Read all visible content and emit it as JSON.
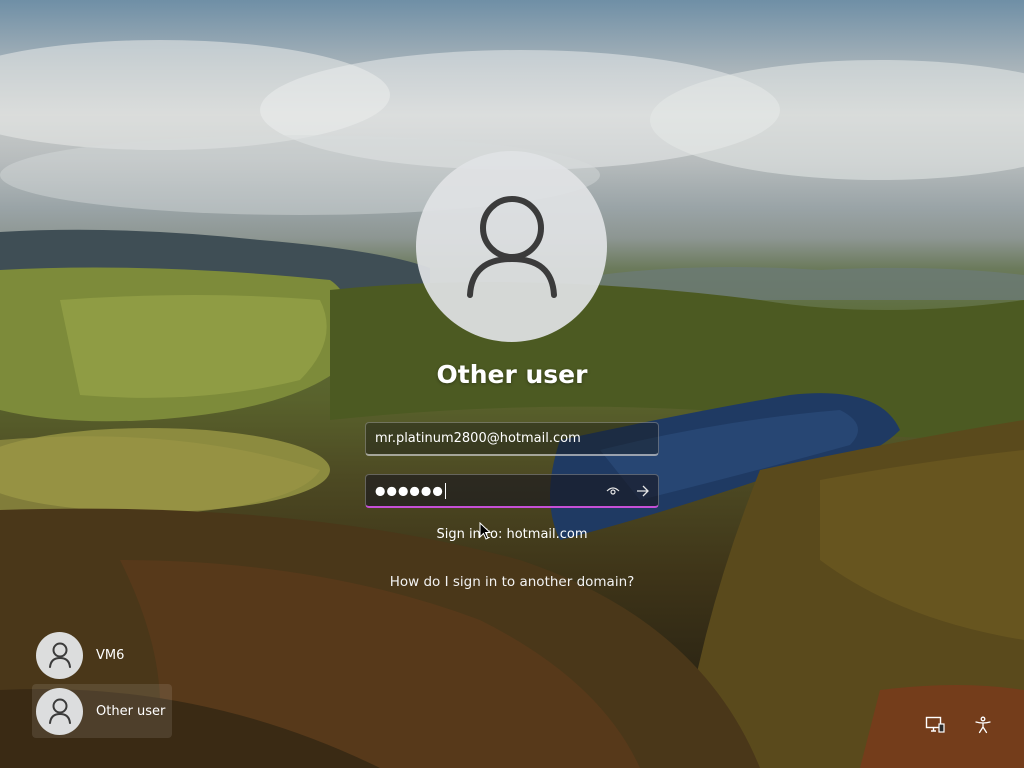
{
  "login": {
    "title": "Other user",
    "username_value": "mr.platinum2800@hotmail.com",
    "password_masked": "●●●●●●",
    "reveal_icon": "eye-icon",
    "submit_icon": "arrow-right-icon",
    "sign_in_to": "Sign in to: hotmail.com",
    "other_domain_link": "How do I sign in to another domain?"
  },
  "users": [
    {
      "name": "VM6",
      "selected": false
    },
    {
      "name": "Other user",
      "selected": true
    }
  ],
  "system_icons": [
    {
      "name": "network-icon"
    },
    {
      "name": "accessibility-icon"
    }
  ],
  "colors": {
    "password_focus_border": "#c54fd6"
  }
}
